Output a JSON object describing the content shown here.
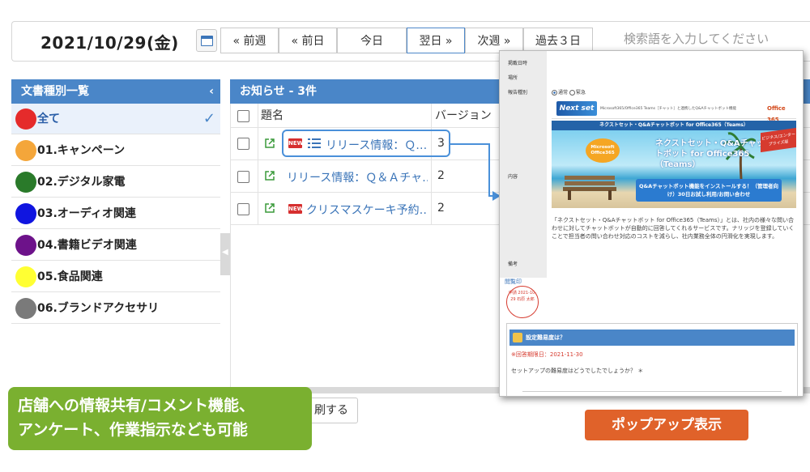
{
  "toolbar": {
    "date": "2021/10/29(金)",
    "buttons": [
      "« 前週",
      "« 前日",
      "今日",
      "翌日 »",
      "次週 »",
      "過去３日"
    ],
    "search_placeholder": "検索語を入力してください"
  },
  "left_panel": {
    "title": "文書種別一覧",
    "collapse_glyph": "‹",
    "categories": [
      {
        "label": "全て",
        "color": "#e52b2b"
      },
      {
        "label": "01.キャンペーン",
        "color": "#f4a63a"
      },
      {
        "label": "02.デジタル家電",
        "color": "#2a7a2a"
      },
      {
        "label": "03.オーディオ関連",
        "color": "#1015e0"
      },
      {
        "label": "04.書籍ビデオ関連",
        "color": "#6d128a"
      },
      {
        "label": "05.食品関連",
        "color": "#ffff33"
      },
      {
        "label": "06.ブランドアクセサリ",
        "color": "#7a7a7a"
      }
    ]
  },
  "main_panel": {
    "title": "お知らせ - 3件",
    "col_title": "題名",
    "col_version": "バージョン",
    "rows": [
      {
        "title": "リリース情報：Ｑ…",
        "version": "3",
        "new": true,
        "list": true
      },
      {
        "title": "リリース情報：Ｑ＆Ａチャ…",
        "version": "2",
        "new": false,
        "list": false
      },
      {
        "title": "クリスマスケーキ予約…",
        "version": "2",
        "new": true,
        "list": false
      }
    ],
    "new_label": "NEW",
    "print_button": "刷する"
  },
  "callouts": {
    "green_line1": "店舗への情報共有/コメント機能、",
    "green_line2": "アンケート、作業指示なども可能",
    "orange": "ポップアップ表示"
  },
  "popup": {
    "side_labels": [
      "掲載日時",
      "場所",
      "報告種別",
      "内容",
      "備考"
    ],
    "radio_normal": "通常",
    "radio_urgent": "緊急",
    "logo_text": "Next set",
    "banner_header_small": "Microsoft365/Office365 Teams［チャット］と連携したQ&Aチャットボット機能",
    "office_logo": "Office 365",
    "strip_title": "ネクストセット・Q&Aチャットボット for Office365（Teams）",
    "badge_text": "Microsoft Office365",
    "banner_title": "ネクストセット・Q&Aチャットボット for Office365（Teams）",
    "banner_button": "Q&Aチャットボット機能をインストールする！（管理者向け）30日お試し利用/お問い合わせ",
    "corner_text": "ビジネス/エンタープライズ版",
    "description": "「ネクストセット・Q&Aチャットボット for Office365（Teams）」とは、社内の様々な問い合わせに対してチャットボットが自動的に回答してくれるサービスです。ナリッジを登録していくことで担当者の問い合わせ対応のコストを減らし、社内業務全体の円滑化を実現します。",
    "stamp_label": "閲覧印",
    "stamp_text": "申請 2021-10-29 石原 太郎",
    "question_title": "設定難易度は？",
    "deadline": "※回答期限日：2021-11-30",
    "question": "セットアップの難易度はどうでしたでしょうか？ ＊"
  }
}
